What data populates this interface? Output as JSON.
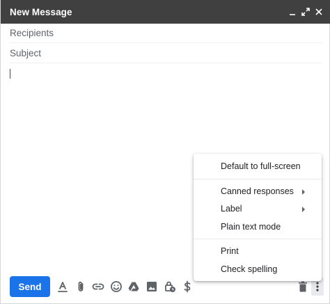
{
  "window": {
    "title": "New Message",
    "controls": [
      "minimize-icon",
      "expand-icon",
      "close-icon"
    ]
  },
  "fields": {
    "recipients_placeholder": "Recipients",
    "subject_placeholder": "Subject"
  },
  "toolbar": {
    "send_label": "Send",
    "tools": [
      "format-text-icon",
      "attach-icon",
      "link-icon",
      "emoji-icon",
      "drive-icon",
      "photo-icon",
      "confidential-icon",
      "money-icon"
    ],
    "right_tools": [
      "trash-icon",
      "more-options-icon"
    ]
  },
  "menu": {
    "groups": [
      [
        {
          "label": "Default to full-screen",
          "submenu": false
        }
      ],
      [
        {
          "label": "Canned responses",
          "submenu": true
        },
        {
          "label": "Label",
          "submenu": true
        },
        {
          "label": "Plain text mode",
          "submenu": false
        }
      ],
      [
        {
          "label": "Print",
          "submenu": false
        },
        {
          "label": "Check spelling",
          "submenu": false
        }
      ]
    ]
  },
  "colors": {
    "titlebar": "#404040",
    "send_button": "#1a73e8",
    "icon": "#5f6368"
  }
}
